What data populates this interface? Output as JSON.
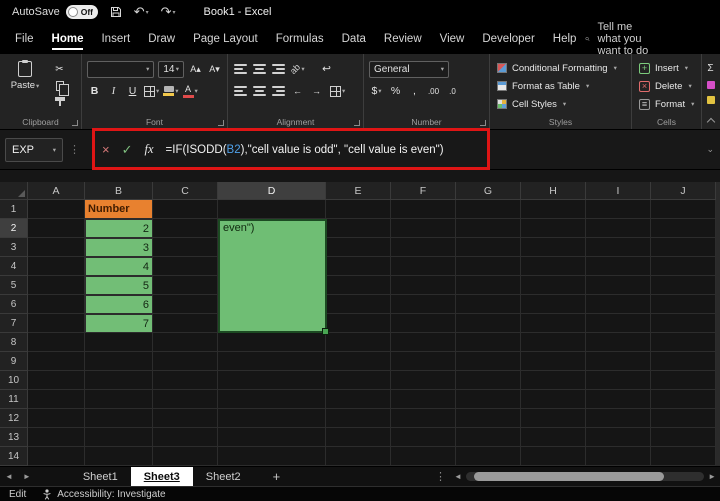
{
  "titlebar": {
    "autosave_label": "AutoSave",
    "autosave_state": "Off",
    "title": "Book1 - Excel"
  },
  "menu": {
    "tabs": [
      "File",
      "Home",
      "Insert",
      "Draw",
      "Page Layout",
      "Formulas",
      "Data",
      "Review",
      "View",
      "Developer",
      "Help"
    ],
    "active_tab": "Home",
    "search_label": "Tell me what you want to do"
  },
  "ribbon": {
    "clipboard": {
      "label": "Clipboard",
      "paste_label": "Paste"
    },
    "font": {
      "label": "Font",
      "font_name": "",
      "font_size": "14",
      "bold": "B",
      "italic": "I",
      "underline": "U",
      "grow_font": "A▴",
      "shrink_font": "A▾"
    },
    "alignment": {
      "label": "Alignment",
      "orientation_glyph": "ab",
      "wrap_glyph": "↩"
    },
    "number": {
      "label": "Number",
      "format": "General",
      "currency": "$",
      "percent": "%",
      "comma": ",",
      "inc_decimal": ".00",
      "dec_decimal": ".0"
    },
    "styles": {
      "label": "Styles",
      "items": [
        "Conditional Formatting",
        "Format as Table",
        "Cell Styles"
      ]
    },
    "cells": {
      "label": "Cells",
      "items": [
        "Insert",
        "Delete",
        "Format"
      ]
    },
    "editing": {
      "autosum": "Σ"
    }
  },
  "formula_bar": {
    "name_box": "EXP",
    "cancel_glyph": "×",
    "enter_glyph": "✓",
    "fx_label": "fx",
    "formula_prefix": "=IF(ISODD(",
    "formula_ref": "B2",
    "formula_suffix": "),\"cell value is odd\", \"cell value is even\")"
  },
  "grid": {
    "columns": [
      "A",
      "B",
      "C",
      "D",
      "E",
      "F",
      "G",
      "H",
      "I",
      "J"
    ],
    "row_count": 14,
    "selected_column": "D",
    "selected_row": 2,
    "cells": {
      "B1": "Number",
      "B2": "2",
      "B3": "3",
      "B4": "4",
      "B5": "5",
      "B6": "6",
      "B7": "7",
      "D2": "even\")"
    },
    "orange_cells": [
      "B1"
    ],
    "green_cells": [
      "B2",
      "B3",
      "B4",
      "B5",
      "B6",
      "B7"
    ]
  },
  "sheets": {
    "tabs": [
      "Sheet1",
      "Sheet3",
      "Sheet2"
    ],
    "active_tab": "Sheet3",
    "add_label": "+"
  },
  "status": {
    "mode": "Edit",
    "accessibility": "Accessibility: Investigate"
  },
  "colors": {
    "green_fill": "#72BE76",
    "orange_fill": "#E8812F",
    "annotation_red": "#DF1515",
    "reference_blue": "#4FA0E8"
  }
}
